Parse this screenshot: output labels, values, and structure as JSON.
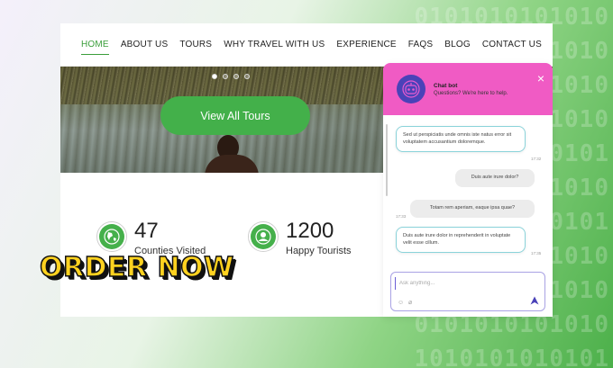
{
  "nav": {
    "items": [
      {
        "label": "HOME",
        "active": true
      },
      {
        "label": "ABOUT US",
        "active": false
      },
      {
        "label": "TOURS",
        "active": false
      },
      {
        "label": "WHY TRAVEL WITH US",
        "active": false
      },
      {
        "label": "EXPERIENCE",
        "active": false
      },
      {
        "label": "FAQS",
        "active": false
      },
      {
        "label": "BLOG",
        "active": false
      },
      {
        "label": "CONTACT US",
        "active": false
      }
    ]
  },
  "hero": {
    "button_label": "View All Tours",
    "slide_count": 4,
    "active_slide": 1
  },
  "stats": [
    {
      "number": "47",
      "label": "Counties Visited",
      "icon": "globe-icon"
    },
    {
      "number": "1200",
      "label": "Happy Tourists",
      "icon": "user-icon"
    }
  ],
  "promo": {
    "text": "ORDER NOW"
  },
  "chat": {
    "title": "Chat bot",
    "subtitle": "Questions? We're here to help.",
    "close_symbol": "×",
    "messages": [
      {
        "from": "bot",
        "text": "Sed ut perspiciatis unde omnis iste natus error sit voluptatem accusantium doloremque.",
        "time": "17:32"
      },
      {
        "from": "user",
        "text": "Duis aute irure dolor?",
        "time": ""
      },
      {
        "from": "user",
        "text": "Totam rem aperiam, eaque ipsa quae?",
        "time": "17:33"
      },
      {
        "from": "bot",
        "text": "Duis aute irure dolor in reprehenderit in voluptate velit esse cillum.",
        "time": "17:35"
      }
    ],
    "input_placeholder": "Ask anything..."
  },
  "colors": {
    "accent_green": "#43b04a",
    "chat_header": "#f05bc4",
    "bot_avatar": "#4a42b8",
    "promo_yellow": "#ffd21f"
  }
}
